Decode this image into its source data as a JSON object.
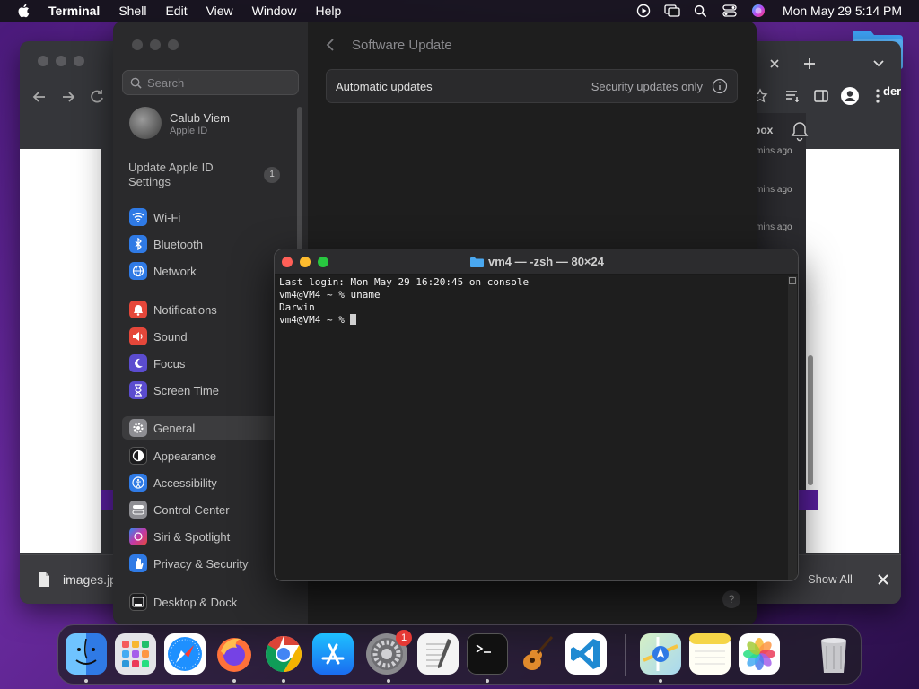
{
  "menubar": {
    "app_name": "Terminal",
    "items": [
      "Shell",
      "Edit",
      "View",
      "Window",
      "Help"
    ],
    "clock": "Mon May 29  5:14 PM"
  },
  "chrome": {
    "download_file": "images.jp",
    "show_all": "Show All",
    "tab_partial": "der",
    "inbox_partial": "box",
    "times": [
      "mins ago",
      "mins ago",
      "mins ago"
    ]
  },
  "settings": {
    "search_placeholder": "Search",
    "user_name": "Calub Viem",
    "user_sub": "Apple ID",
    "update_apple_id": "Update Apple ID Settings",
    "update_badge": "1",
    "sidebar_items": [
      {
        "label": "Wi-Fi",
        "icon": "wifi-icon",
        "color": "#2f7ae5"
      },
      {
        "label": "Bluetooth",
        "icon": "bluetooth-icon",
        "color": "#2f7ae5"
      },
      {
        "label": "Network",
        "icon": "globe-icon",
        "color": "#2f7ae5"
      },
      {
        "label": "Notifications",
        "icon": "bell-icon",
        "color": "#e5473a"
      },
      {
        "label": "Sound",
        "icon": "speaker-icon",
        "color": "#e5473a"
      },
      {
        "label": "Focus",
        "icon": "moon-icon",
        "color": "#5b4ccf"
      },
      {
        "label": "Screen Time",
        "icon": "hourglass-icon",
        "color": "#5b4ccf"
      },
      {
        "label": "General",
        "icon": "gear-icon",
        "color": "#8e8e93"
      },
      {
        "label": "Appearance",
        "icon": "appearance-icon",
        "color": "#1c1c1e"
      },
      {
        "label": "Accessibility",
        "icon": "accessibility-icon",
        "color": "#2f7ae5"
      },
      {
        "label": "Control Center",
        "icon": "control-center-icon",
        "color": "#8e8e93"
      },
      {
        "label": "Siri & Spotlight",
        "icon": "siri-icon",
        "color": "#c03aa8"
      },
      {
        "label": "Privacy & Security",
        "icon": "hand-icon",
        "color": "#2f7ae5"
      },
      {
        "label": "Desktop & Dock",
        "icon": "dock-icon",
        "color": "#1c1c1e"
      }
    ],
    "panel_title": "Software Update",
    "auto_label": "Automatic updates",
    "auto_value": "Security updates only",
    "help": "?"
  },
  "terminal": {
    "title": "vm4 — -zsh — 80×24",
    "lines": [
      "Last login: Mon May 29 16:20:45 on console",
      "vm4@VM4 ~ % uname",
      "Darwin",
      "vm4@VM4 ~ % "
    ]
  },
  "dock": {
    "apps": [
      {
        "name": "Finder",
        "color": "#3b8fe8"
      },
      {
        "name": "Launchpad",
        "color": "#d8d8d8"
      },
      {
        "name": "Safari",
        "color": "#1e90ff"
      },
      {
        "name": "Firefox",
        "color": "#ff7139"
      },
      {
        "name": "Chrome",
        "color": "#ffffff"
      },
      {
        "name": "App Store",
        "color": "#1a8cff"
      },
      {
        "name": "System Settings",
        "color": "#8a8a8e"
      },
      {
        "name": "TextEdit",
        "color": "#f2f2f2"
      },
      {
        "name": "Terminal",
        "color": "#111111"
      },
      {
        "name": "GarageBand",
        "color": "#e08a2c"
      },
      {
        "name": "Visual Studio Code",
        "color": "#ffffff"
      },
      {
        "name": "Maps",
        "color": "#4caf50"
      },
      {
        "name": "Notes",
        "color": "#f5d547"
      },
      {
        "name": "Photos",
        "color": "#ffffff"
      },
      {
        "name": "Trash",
        "color": "#b0b0b0"
      }
    ],
    "settings_badge": "1"
  }
}
